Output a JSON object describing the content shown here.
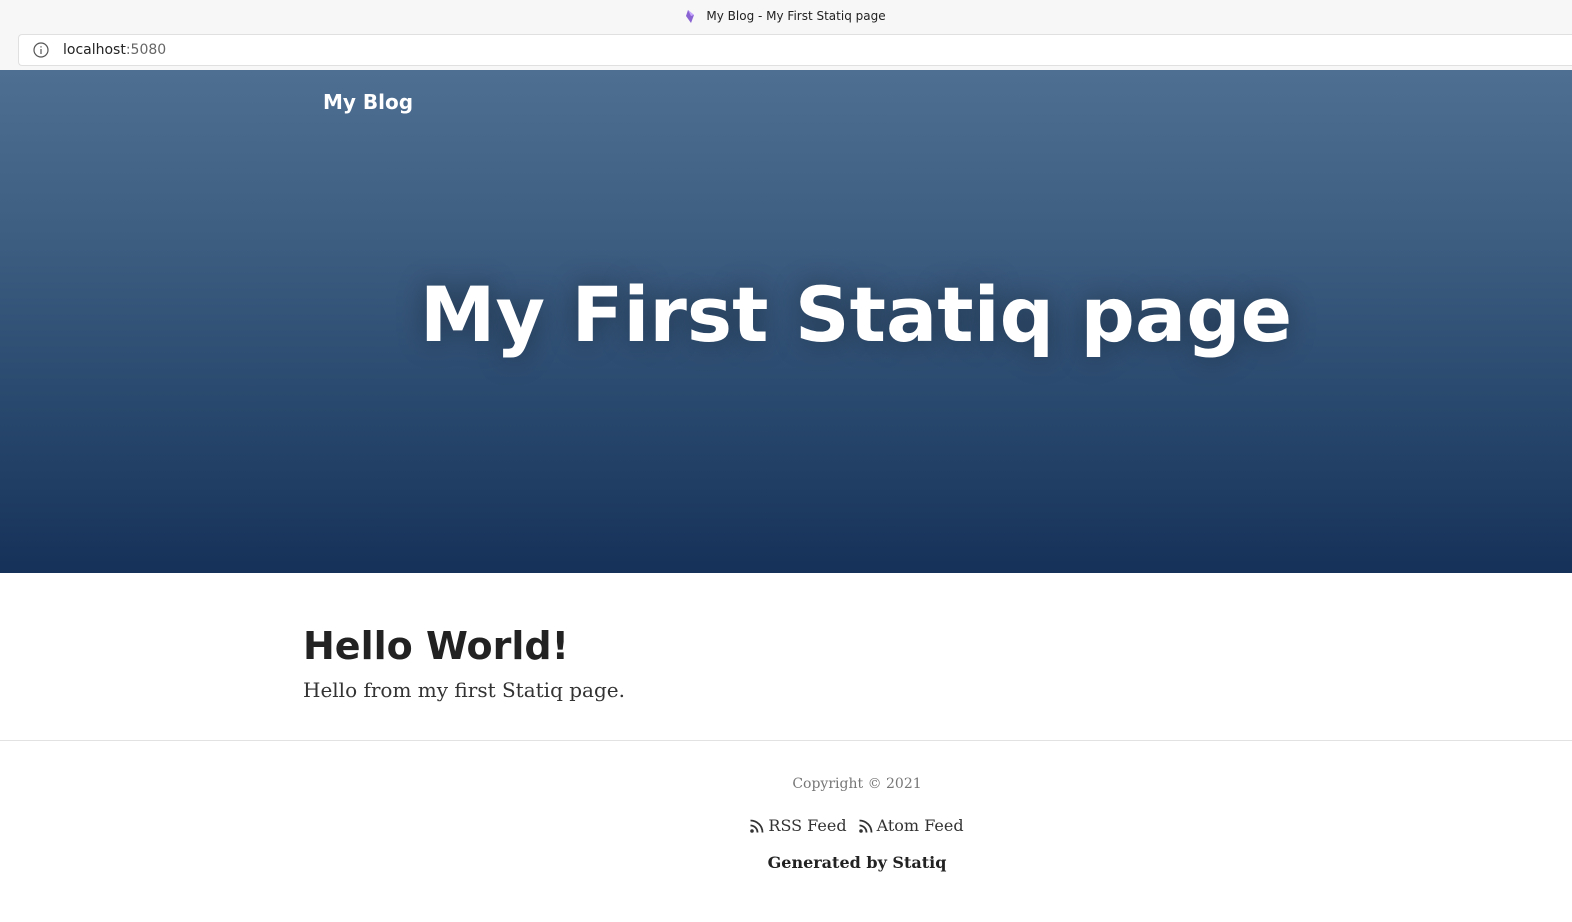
{
  "browser": {
    "tab_title": "My Blog - My First Statiq page",
    "url_host": "localhost",
    "url_port": ":5080"
  },
  "header": {
    "brand": "My Blog",
    "hero_title": "My First Statiq page"
  },
  "content": {
    "heading": "Hello World!",
    "body": "Hello from my first Statiq page."
  },
  "footer": {
    "copyright": "Copyright © 2021",
    "rss_label": "RSS Feed",
    "atom_label": "Atom Feed",
    "generated": "Generated by Statiq"
  },
  "colors": {
    "hero_top": "#4e6e92",
    "hero_bottom": "#163159",
    "heading_text": "#222222"
  },
  "icons": {
    "tab": "statiq-favicon-icon",
    "address": "info-icon",
    "feed": "rss-icon"
  }
}
